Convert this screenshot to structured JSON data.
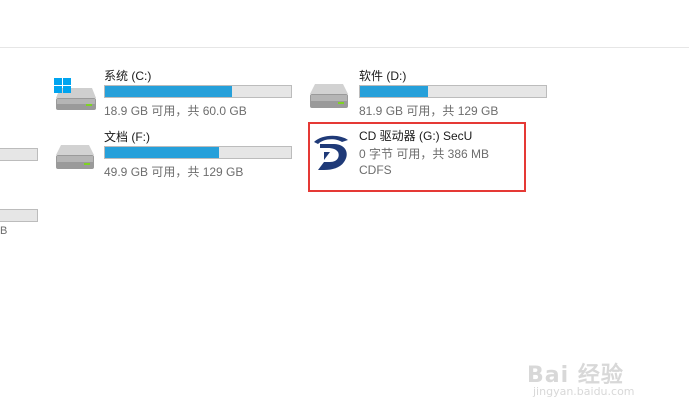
{
  "drives": [
    {
      "name": "系统 (C:)",
      "info": "18.9 GB 可用，共 60.0 GB",
      "used_fraction": 0.685,
      "icon": "windows-drive-icon"
    },
    {
      "name": "软件 (D:)",
      "info": "81.9 GB 可用，共 129 GB",
      "used_fraction": 0.365,
      "icon": "hard-drive-icon"
    },
    {
      "name": "文档 (F:)",
      "info": "49.9 GB 可用，共 129 GB",
      "used_fraction": 0.613,
      "icon": "hard-drive-icon"
    }
  ],
  "cd_drive": {
    "name": "CD 驱动器 (G:) SecU",
    "info": "0 字节 可用，共 386 MB",
    "filesystem": "CDFS",
    "icon": "secu-disc-icon"
  },
  "partial_left": {
    "text": "B"
  },
  "watermark": {
    "logo": "Bai 经验",
    "url": "jingyan.baidu.com"
  },
  "colors": {
    "bar_fill": "#26a0da",
    "bar_bg": "#e6e6e6",
    "highlight": "#e53935"
  }
}
